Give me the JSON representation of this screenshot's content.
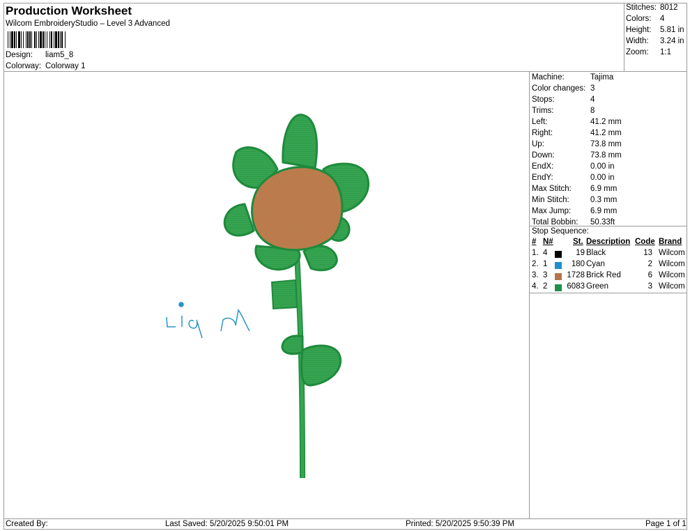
{
  "header": {
    "title": "Production Worksheet",
    "subtitle": "Wilcom EmbroideryStudio – Level 3 Advanced",
    "design_label": "Design:",
    "design_value": "liam5_8",
    "colorway_label": "Colorway:",
    "colorway_value": "Colorway 1"
  },
  "stats": [
    {
      "label": "Stitches:",
      "value": "8012"
    },
    {
      "label": "Colors:",
      "value": "4"
    },
    {
      "label": "Height:",
      "value": "5.81 in"
    },
    {
      "label": "Width:",
      "value": "3.24 in"
    },
    {
      "label": "Zoom:",
      "value": "1:1"
    }
  ],
  "machine_info": [
    {
      "label": "Machine:",
      "value": "Tajima"
    },
    {
      "label": "Color changes:",
      "value": "3"
    },
    {
      "label": "Stops:",
      "value": "4"
    },
    {
      "label": "Trims:",
      "value": "8"
    },
    {
      "label": "Left:",
      "value": "41.2 mm"
    },
    {
      "label": "Right:",
      "value": "41.2 mm"
    },
    {
      "label": "Up:",
      "value": "73.8 mm"
    },
    {
      "label": "Down:",
      "value": "73.8 mm"
    },
    {
      "label": "EndX:",
      "value": "0.00 in"
    },
    {
      "label": "EndY:",
      "value": "0.00 in"
    },
    {
      "label": "Max Stitch:",
      "value": "6.9 mm"
    },
    {
      "label": "Min Stitch:",
      "value": "0.3 mm"
    },
    {
      "label": "Max Jump:",
      "value": "6.9 mm"
    },
    {
      "label": "Total Bobbin:",
      "value": "50.33ft"
    }
  ],
  "stop_sequence": {
    "title": "Stop Sequence:",
    "headers": {
      "num": "#",
      "n": "N#",
      "st": "St.",
      "desc": "Description",
      "code": "Code",
      "brand": "Brand"
    },
    "rows": [
      {
        "num": "1.",
        "n": "4",
        "color": "#000000",
        "st": "19",
        "desc": "Black",
        "code": "13",
        "brand": "Wilcom"
      },
      {
        "num": "2.",
        "n": "1",
        "color": "#1e8fd0",
        "st": "180",
        "desc": "Cyan",
        "code": "2",
        "brand": "Wilcom"
      },
      {
        "num": "3.",
        "n": "3",
        "color": "#b5744a",
        "st": "1728",
        "desc": "Brick Red",
        "code": "6",
        "brand": "Wilcom"
      },
      {
        "num": "4.",
        "n": "2",
        "color": "#1f8f4a",
        "st": "6083",
        "desc": "Green",
        "code": "3",
        "brand": "Wilcom"
      }
    ]
  },
  "footer": {
    "created_by": "Created By:",
    "last_saved": "Last Saved: 5/20/2025 9:50:01 PM",
    "printed": "Printed: 5/20/2025 9:50:39 PM",
    "page": "Page 1 of 1"
  },
  "design_colors": {
    "green_fill": "#35a551",
    "green_edge": "#1e8a3c",
    "brown_fill": "#bf7f4f",
    "cyan": "#2b93c6"
  }
}
